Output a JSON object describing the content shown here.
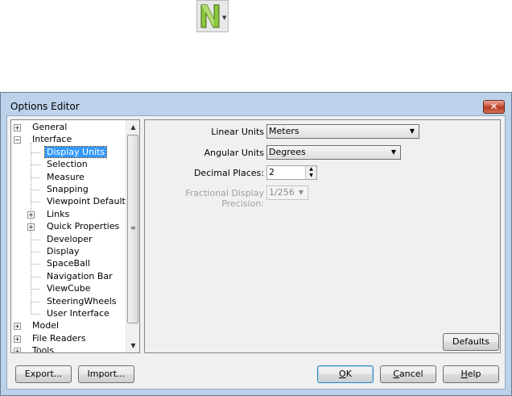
{
  "window": {
    "title": "Options Editor",
    "close_glyph": "✕"
  },
  "tree": {
    "items": [
      {
        "label": "General",
        "level": 0,
        "expander": "+"
      },
      {
        "label": "Interface",
        "level": 0,
        "expander": "−"
      },
      {
        "label": "Display Units",
        "level": 1,
        "selected": true
      },
      {
        "label": "Selection",
        "level": 1
      },
      {
        "label": "Measure",
        "level": 1
      },
      {
        "label": "Snapping",
        "level": 1
      },
      {
        "label": "Viewpoint Defaults",
        "level": 1
      },
      {
        "label": "Links",
        "level": 1,
        "expander": "+"
      },
      {
        "label": "Quick Properties",
        "level": 1,
        "expander": "+"
      },
      {
        "label": "Developer",
        "level": 1
      },
      {
        "label": "Display",
        "level": 1
      },
      {
        "label": "SpaceBall",
        "level": 1
      },
      {
        "label": "Navigation Bar",
        "level": 1
      },
      {
        "label": "ViewCube",
        "level": 1
      },
      {
        "label": "SteeringWheels",
        "level": 1
      },
      {
        "label": "User Interface",
        "level": 1
      },
      {
        "label": "Model",
        "level": 0,
        "expander": "+"
      },
      {
        "label": "File Readers",
        "level": 0,
        "expander": "+"
      },
      {
        "label": "Tools",
        "level": 0,
        "expander": "+"
      }
    ]
  },
  "panel": {
    "linear_units": {
      "label": "Linear Units",
      "value": "Meters"
    },
    "angular_units": {
      "label": "Angular Units",
      "value": "Degrees"
    },
    "decimal_places": {
      "label": "Decimal Places:",
      "value": "2"
    },
    "fractional_precision": {
      "label": "Fractional Display Precision:",
      "value": "1/256"
    },
    "defaults_button": "Defaults"
  },
  "footer": {
    "export_button": "Export...",
    "import_button": "Import...",
    "ok_button": {
      "mnemonic": "O",
      "rest": "K"
    },
    "cancel_button": {
      "mnemonic": "C",
      "rest": "ancel"
    },
    "help_button": {
      "mnemonic": "H",
      "rest": "elp"
    }
  },
  "colors": {
    "window_frame": "#bcd1ea",
    "selection": "#3399ff",
    "close_button": "#c8482f"
  },
  "icons": [
    "navisworks-logo-icon",
    "dropdown-arrow-icon",
    "close-icon",
    "scroll-up-icon",
    "scroll-down-icon"
  ]
}
